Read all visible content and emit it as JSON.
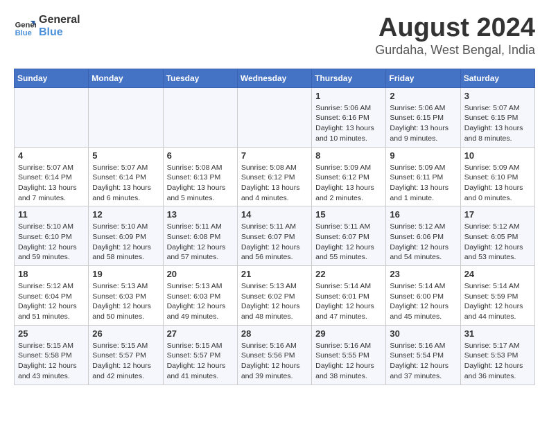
{
  "header": {
    "logo_line1": "General",
    "logo_line2": "Blue",
    "title": "August 2024",
    "subtitle": "Gurdaha, West Bengal, India"
  },
  "weekdays": [
    "Sunday",
    "Monday",
    "Tuesday",
    "Wednesday",
    "Thursday",
    "Friday",
    "Saturday"
  ],
  "weeks": [
    [
      {
        "num": "",
        "sunrise": "",
        "sunset": "",
        "daylight": ""
      },
      {
        "num": "",
        "sunrise": "",
        "sunset": "",
        "daylight": ""
      },
      {
        "num": "",
        "sunrise": "",
        "sunset": "",
        "daylight": ""
      },
      {
        "num": "",
        "sunrise": "",
        "sunset": "",
        "daylight": ""
      },
      {
        "num": "1",
        "sunrise": "5:06 AM",
        "sunset": "6:16 PM",
        "daylight": "13 hours and 10 minutes."
      },
      {
        "num": "2",
        "sunrise": "5:06 AM",
        "sunset": "6:15 PM",
        "daylight": "13 hours and 9 minutes."
      },
      {
        "num": "3",
        "sunrise": "5:07 AM",
        "sunset": "6:15 PM",
        "daylight": "13 hours and 8 minutes."
      }
    ],
    [
      {
        "num": "4",
        "sunrise": "5:07 AM",
        "sunset": "6:14 PM",
        "daylight": "13 hours and 7 minutes."
      },
      {
        "num": "5",
        "sunrise": "5:07 AM",
        "sunset": "6:14 PM",
        "daylight": "13 hours and 6 minutes."
      },
      {
        "num": "6",
        "sunrise": "5:08 AM",
        "sunset": "6:13 PM",
        "daylight": "13 hours and 5 minutes."
      },
      {
        "num": "7",
        "sunrise": "5:08 AM",
        "sunset": "6:12 PM",
        "daylight": "13 hours and 4 minutes."
      },
      {
        "num": "8",
        "sunrise": "5:09 AM",
        "sunset": "6:12 PM",
        "daylight": "13 hours and 2 minutes."
      },
      {
        "num": "9",
        "sunrise": "5:09 AM",
        "sunset": "6:11 PM",
        "daylight": "13 hours and 1 minute."
      },
      {
        "num": "10",
        "sunrise": "5:09 AM",
        "sunset": "6:10 PM",
        "daylight": "13 hours and 0 minutes."
      }
    ],
    [
      {
        "num": "11",
        "sunrise": "5:10 AM",
        "sunset": "6:10 PM",
        "daylight": "12 hours and 59 minutes."
      },
      {
        "num": "12",
        "sunrise": "5:10 AM",
        "sunset": "6:09 PM",
        "daylight": "12 hours and 58 minutes."
      },
      {
        "num": "13",
        "sunrise": "5:11 AM",
        "sunset": "6:08 PM",
        "daylight": "12 hours and 57 minutes."
      },
      {
        "num": "14",
        "sunrise": "5:11 AM",
        "sunset": "6:07 PM",
        "daylight": "12 hours and 56 minutes."
      },
      {
        "num": "15",
        "sunrise": "5:11 AM",
        "sunset": "6:07 PM",
        "daylight": "12 hours and 55 minutes."
      },
      {
        "num": "16",
        "sunrise": "5:12 AM",
        "sunset": "6:06 PM",
        "daylight": "12 hours and 54 minutes."
      },
      {
        "num": "17",
        "sunrise": "5:12 AM",
        "sunset": "6:05 PM",
        "daylight": "12 hours and 53 minutes."
      }
    ],
    [
      {
        "num": "18",
        "sunrise": "5:12 AM",
        "sunset": "6:04 PM",
        "daylight": "12 hours and 51 minutes."
      },
      {
        "num": "19",
        "sunrise": "5:13 AM",
        "sunset": "6:03 PM",
        "daylight": "12 hours and 50 minutes."
      },
      {
        "num": "20",
        "sunrise": "5:13 AM",
        "sunset": "6:03 PM",
        "daylight": "12 hours and 49 minutes."
      },
      {
        "num": "21",
        "sunrise": "5:13 AM",
        "sunset": "6:02 PM",
        "daylight": "12 hours and 48 minutes."
      },
      {
        "num": "22",
        "sunrise": "5:14 AM",
        "sunset": "6:01 PM",
        "daylight": "12 hours and 47 minutes."
      },
      {
        "num": "23",
        "sunrise": "5:14 AM",
        "sunset": "6:00 PM",
        "daylight": "12 hours and 45 minutes."
      },
      {
        "num": "24",
        "sunrise": "5:14 AM",
        "sunset": "5:59 PM",
        "daylight": "12 hours and 44 minutes."
      }
    ],
    [
      {
        "num": "25",
        "sunrise": "5:15 AM",
        "sunset": "5:58 PM",
        "daylight": "12 hours and 43 minutes."
      },
      {
        "num": "26",
        "sunrise": "5:15 AM",
        "sunset": "5:57 PM",
        "daylight": "12 hours and 42 minutes."
      },
      {
        "num": "27",
        "sunrise": "5:15 AM",
        "sunset": "5:57 PM",
        "daylight": "12 hours and 41 minutes."
      },
      {
        "num": "28",
        "sunrise": "5:16 AM",
        "sunset": "5:56 PM",
        "daylight": "12 hours and 39 minutes."
      },
      {
        "num": "29",
        "sunrise": "5:16 AM",
        "sunset": "5:55 PM",
        "daylight": "12 hours and 38 minutes."
      },
      {
        "num": "30",
        "sunrise": "5:16 AM",
        "sunset": "5:54 PM",
        "daylight": "12 hours and 37 minutes."
      },
      {
        "num": "31",
        "sunrise": "5:17 AM",
        "sunset": "5:53 PM",
        "daylight": "12 hours and 36 minutes."
      }
    ]
  ],
  "labels": {
    "sunrise_prefix": "Sunrise: ",
    "sunset_prefix": "Sunset: ",
    "daylight_prefix": "Daylight: "
  }
}
